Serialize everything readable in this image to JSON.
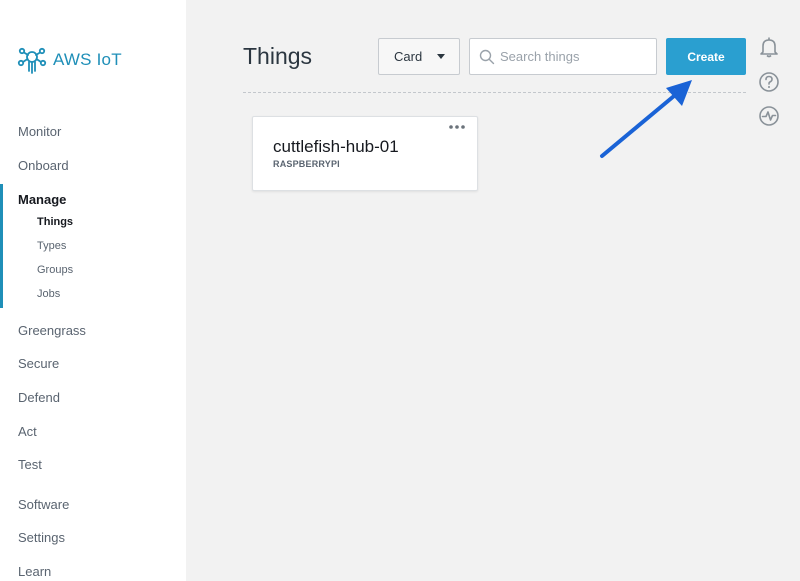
{
  "brand": {
    "name": "AWS IoT",
    "logo_icon": "aws-iot-logo-icon",
    "color": "#1f8fb8"
  },
  "sidebar": {
    "items": [
      {
        "label": "Monitor",
        "active": false
      },
      {
        "label": "Onboard",
        "active": false
      },
      {
        "label": "Manage",
        "active": true
      },
      {
        "label": "Greengrass",
        "active": false
      },
      {
        "label": "Secure",
        "active": false
      },
      {
        "label": "Defend",
        "active": false
      },
      {
        "label": "Act",
        "active": false
      },
      {
        "label": "Test",
        "active": false
      },
      {
        "label": "Software",
        "active": false
      },
      {
        "label": "Settings",
        "active": false
      },
      {
        "label": "Learn",
        "active": false
      }
    ],
    "manage_subitems": [
      {
        "label": "Things",
        "active": true
      },
      {
        "label": "Types",
        "active": false
      },
      {
        "label": "Groups",
        "active": false
      },
      {
        "label": "Jobs",
        "active": false
      }
    ]
  },
  "header": {
    "title": "Things",
    "view_select": {
      "value": "Card"
    },
    "search": {
      "placeholder": "Search things",
      "value": ""
    },
    "create_label": "Create",
    "accent_color": "#2a9fd0"
  },
  "right_rail": {
    "icons": [
      "bell-icon",
      "help-icon",
      "activity-icon"
    ]
  },
  "things": [
    {
      "name": "cuttlefish-hub-01",
      "type": "RASPBERRYPI"
    }
  ],
  "annotation": {
    "arrow_color": "#1a63d6"
  }
}
